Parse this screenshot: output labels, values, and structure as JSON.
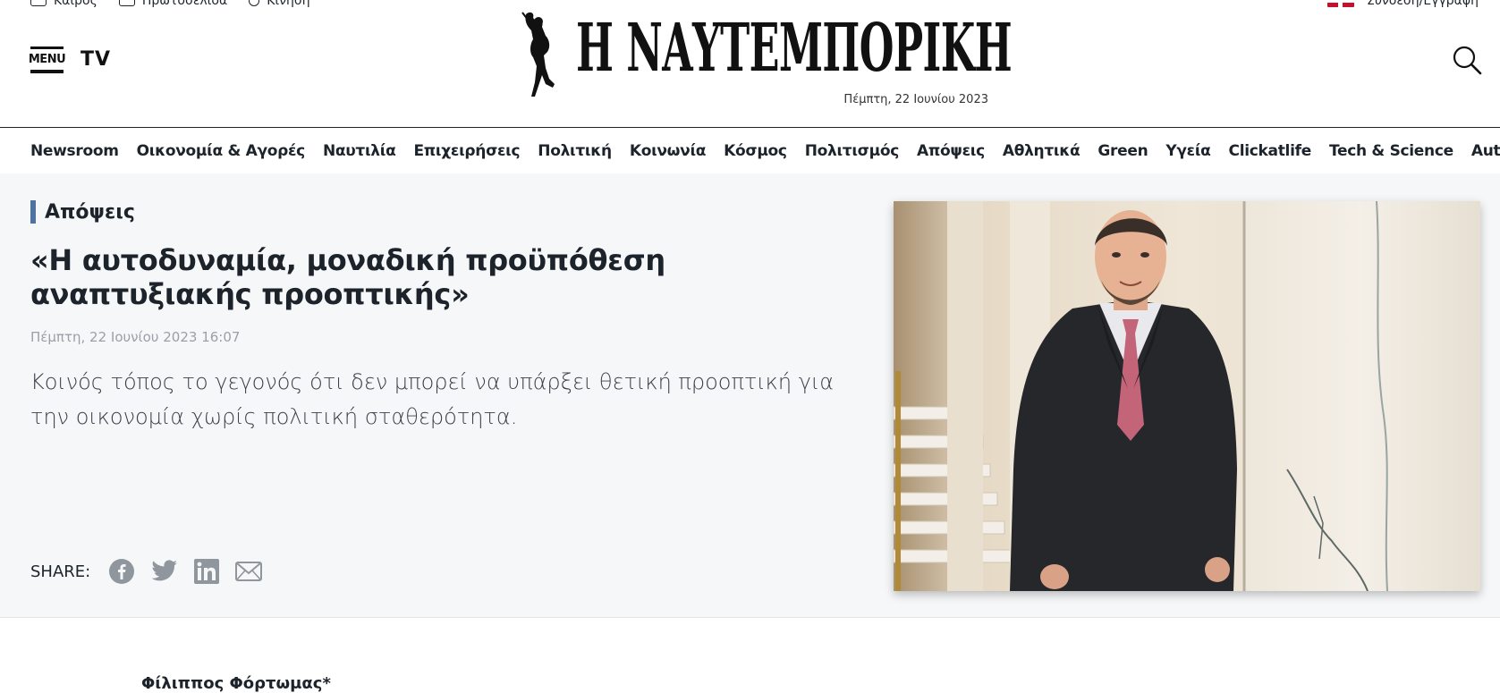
{
  "utility_bar": {
    "items": [
      {
        "label": "Καιρός",
        "icon": "weather-icon"
      },
      {
        "label": "Πρωτοσέλιδα",
        "icon": "newspaper-icon"
      },
      {
        "label": "Κίνηση",
        "icon": "traffic-icon"
      }
    ],
    "login_label": "Σύνδεση/Εγγραφή",
    "language_icon": "uk-flag-icon"
  },
  "header": {
    "menu_label": "MENU",
    "tv_label": "TV",
    "logo_text": "Η ΝΑΥΤΕΜΠΟΡΙΚΗ",
    "date": "Πέμπτη, 22 Ιουνίου 2023",
    "search_icon": "search-icon"
  },
  "nav": [
    "Newsroom",
    "Οικονομία & Αγορές",
    "Ναυτιλία",
    "Επιχειρήσεις",
    "Πολιτική",
    "Κοινωνία",
    "Κόσμος",
    "Πολιτισμός",
    "Απόψεις",
    "Αθλητικά",
    "Green",
    "Υγεία",
    "Clickatlife",
    "Tech & Science",
    "Auto"
  ],
  "article": {
    "category": "Απόψεις",
    "title": "«Η αυτοδυναμία, μοναδική προϋπόθεση αναπτυξιακής προοπτικής»",
    "datetime": "Πέμπτη, 22 Ιουνίου 2023 16:07",
    "lead": "Κοινός τόπος το γεγονός ότι δεν μπορεί να υπάρξει θετική προοπτική για την οικονομία χωρίς πολιτική σταθερότητα.",
    "share_label": "SHARE:",
    "share_icons": [
      "facebook-icon",
      "twitter-icon",
      "linkedin-icon",
      "email-icon"
    ],
    "author": "Φίλιππος Φόρτωμας*"
  },
  "colors": {
    "accent": "#4f73a1",
    "hero_bg": "#f6f7f9",
    "text": "#1d232b",
    "share_icon": "#8f969e"
  }
}
